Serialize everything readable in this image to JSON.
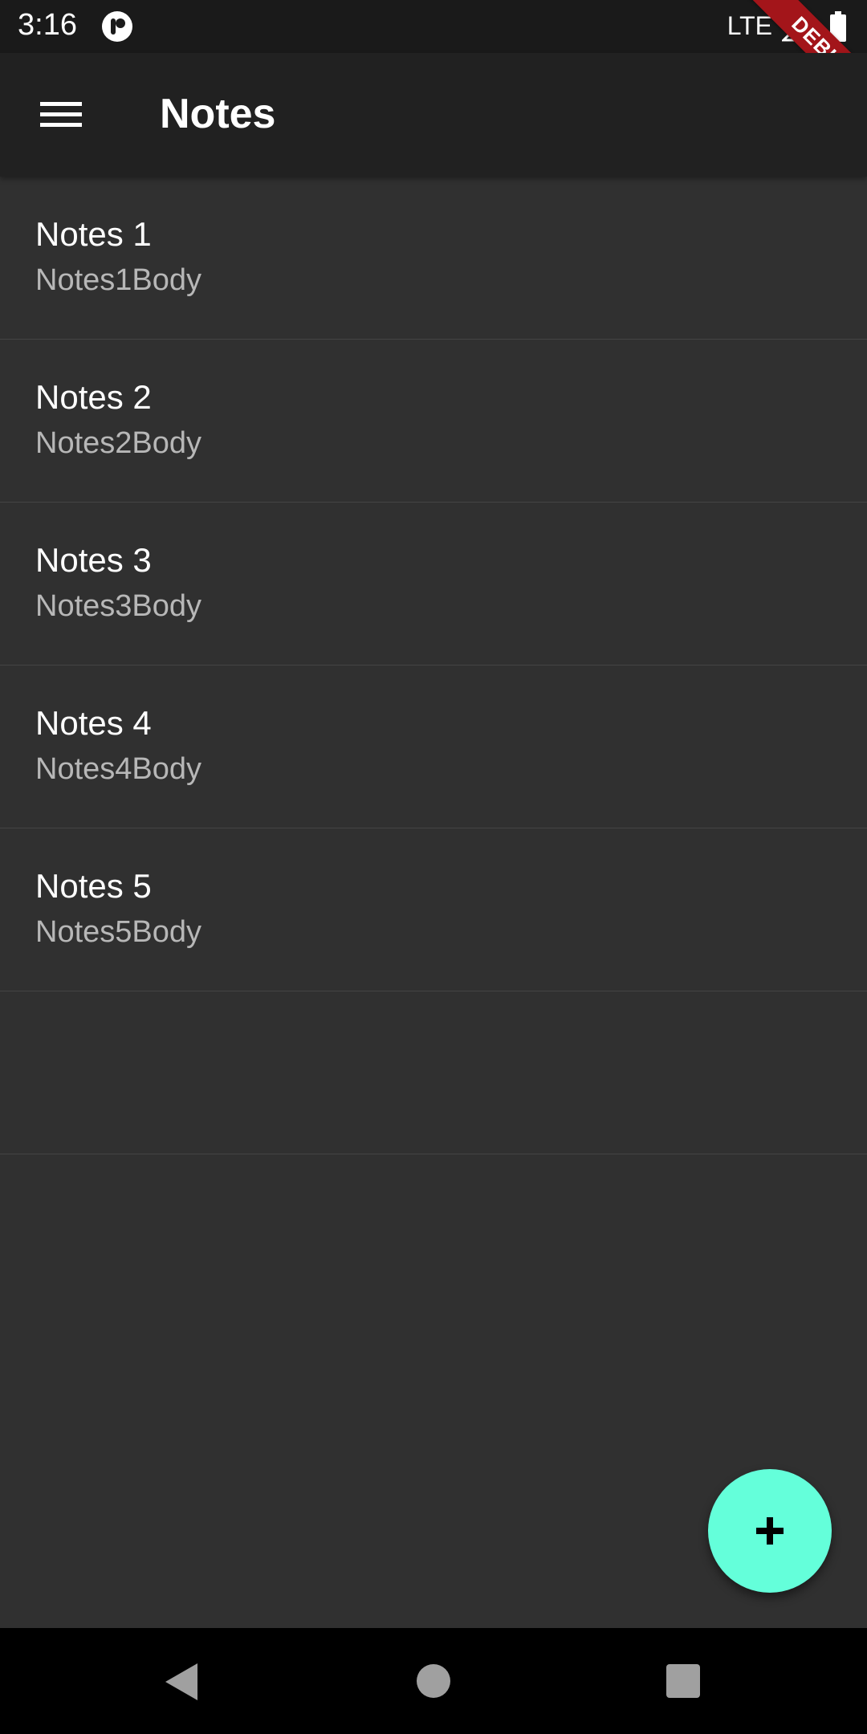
{
  "status_bar": {
    "time": "3:16",
    "network": "LTE",
    "icons": [
      "app-notification-icon",
      "signal-icon",
      "battery-icon"
    ]
  },
  "debug_banner": "DEBUG",
  "app_bar": {
    "title": "Notes",
    "menu_icon": "menu-icon"
  },
  "notes": [
    {
      "title": "Notes 1",
      "body": "Notes1Body"
    },
    {
      "title": "Notes 2",
      "body": "Notes2Body"
    },
    {
      "title": "Notes 3",
      "body": "Notes3Body"
    },
    {
      "title": "Notes 4",
      "body": "Notes4Body"
    },
    {
      "title": "Notes 5",
      "body": "Notes5Body"
    }
  ],
  "fab": {
    "icon": "add-icon",
    "color": "#64ffda"
  },
  "colors": {
    "background": "#303030",
    "app_bar": "#212121",
    "status_bar": "#1a1a1a",
    "debug_banner": "#a3151a",
    "accent": "#64ffda"
  },
  "nav_bar": {
    "icons": [
      "back-icon",
      "home-icon",
      "recents-icon"
    ]
  }
}
